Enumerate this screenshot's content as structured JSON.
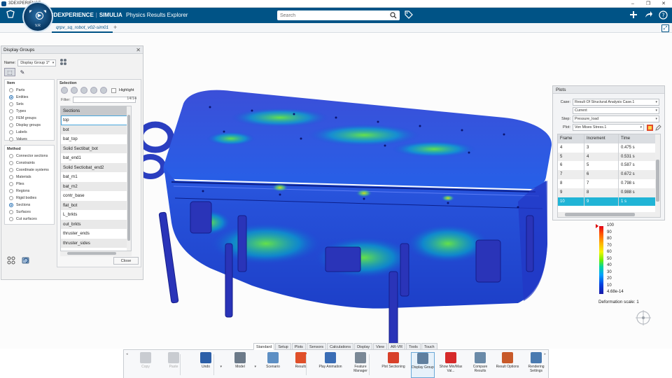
{
  "os": {
    "app_name": "3DEXPERIENCE",
    "minimize": "–",
    "restore": "❐",
    "close": "✕"
  },
  "header": {
    "brand": "3DEXPERIENCE",
    "separator": "|",
    "product": "SIMULIA",
    "app": "Physics Results Explorer",
    "compass_version": "V.R",
    "search_placeholder": "Search"
  },
  "tabs": {
    "document": "qrpv_sq_robot_v02-sim01",
    "add": "+"
  },
  "display_groups": {
    "title": "Display Groups",
    "name_label": "Name:",
    "name_value": "Display Group 1*",
    "item_header": "Item",
    "items": [
      {
        "label": "Parts",
        "selected": false
      },
      {
        "label": "Entities",
        "selected": true
      },
      {
        "label": "Sets",
        "selected": false
      },
      {
        "label": "Types",
        "selected": false
      },
      {
        "label": "FEM groups",
        "selected": false
      },
      {
        "label": "Display groups",
        "selected": false
      },
      {
        "label": "Labels",
        "selected": false
      },
      {
        "label": "Values",
        "selected": false
      }
    ],
    "method_header": "Method",
    "methods": [
      {
        "label": "Connector sections",
        "selected": false
      },
      {
        "label": "Constraints",
        "selected": false
      },
      {
        "label": "Coordinate systems",
        "selected": false
      },
      {
        "label": "Materials",
        "selected": false
      },
      {
        "label": "Plies",
        "selected": false
      },
      {
        "label": "Regions",
        "selected": false
      },
      {
        "label": "Rigid bodies",
        "selected": false
      },
      {
        "label": "Sections",
        "selected": true
      },
      {
        "label": "Surfaces",
        "selected": false
      },
      {
        "label": "Cut surfaces",
        "selected": false
      }
    ],
    "selection_header": "Selection",
    "highlight_label": "Highlight",
    "filter_label": "Filter:",
    "filter_value": "",
    "filter_count": "14/14",
    "sections_header": "Sections",
    "sections": [
      "top",
      "bot",
      "bat_top",
      "Solid Sectibat_bot",
      "bat_end1",
      "Solid Sectiobat_end2",
      "bat_m1",
      "bat_m2",
      "contr_base",
      "flat_bot",
      "L_brkts",
      "out_brkts",
      "thruster_ends",
      "thruster_sides"
    ],
    "close_label": "Close"
  },
  "plots": {
    "title": "Plots",
    "case_label": "Case:",
    "case_value": "Result Of Structural Analysis Case.1",
    "current_value": "Current",
    "step_label": "Step:",
    "step_value": "Pressure_load",
    "plot_label": "Plot:",
    "plot_value": "Von Mises Stress.1",
    "columns": [
      "Frame",
      "Increment",
      "Time"
    ],
    "rows": [
      {
        "frame": "4",
        "increment": "3",
        "time": "0.475 s"
      },
      {
        "frame": "5",
        "increment": "4",
        "time": "0.531 s"
      },
      {
        "frame": "6",
        "increment": "5",
        "time": "0.587 s"
      },
      {
        "frame": "7",
        "increment": "6",
        "time": "0.672 s"
      },
      {
        "frame": "8",
        "increment": "7",
        "time": "0.798 s"
      },
      {
        "frame": "9",
        "increment": "8",
        "time": "0.988 s"
      },
      {
        "frame": "10",
        "increment": "9",
        "time": "1 s"
      }
    ],
    "selected_frame": "10"
  },
  "legend": {
    "ticks": [
      "100",
      "90",
      "80",
      "70",
      "60",
      "50",
      "40",
      "30",
      "20",
      "10",
      "4.68e-14"
    ],
    "deformation_label": "Deformation scale: 1"
  },
  "section_tabs": [
    "Standard",
    "Setup",
    "Plots",
    "Sensors",
    "Calculations",
    "Display",
    "View",
    "AR-VR",
    "Tools",
    "Touch"
  ],
  "active_section_tab": "Standard",
  "actions": [
    {
      "id": "copy",
      "label": "Copy",
      "disabled": true,
      "color": "#c9ccd1"
    },
    {
      "id": "paste",
      "label": "Paste",
      "disabled": true,
      "color": "#c9ccd1"
    },
    {
      "id": "undo",
      "label": "Undo",
      "disabled": false,
      "color": "#2c5fa8"
    },
    {
      "id": "model",
      "label": "Model",
      "disabled": false,
      "color": "#6c7a89"
    },
    {
      "id": "scenario",
      "label": "Scenario",
      "disabled": false,
      "color": "#5d8fc4"
    },
    {
      "id": "results",
      "label": "Results",
      "disabled": false,
      "color": "#e0502a"
    },
    {
      "id": "play-animation",
      "label": "Play Animation",
      "disabled": false,
      "color": "#3a6db5"
    },
    {
      "id": "feature-manager",
      "label": "Feature Manager",
      "disabled": false,
      "color": "#7a8896"
    },
    {
      "id": "plot-sectioning",
      "label": "Plot Sectioning",
      "disabled": false,
      "color": "#d8402a"
    },
    {
      "id": "display-group",
      "label": "Display Group",
      "disabled": false,
      "color": "#5f7f9f"
    },
    {
      "id": "show-minmax",
      "label": "Show Min/Max Val...",
      "disabled": false,
      "color": "#d62a2a"
    },
    {
      "id": "compare-results",
      "label": "Compare Results",
      "disabled": false,
      "color": "#6a8aa8"
    },
    {
      "id": "result-options",
      "label": "Result Options",
      "disabled": false,
      "color": "#c85a2a"
    },
    {
      "id": "rendering-settings",
      "label": "Rendering Settings",
      "disabled": false,
      "color": "#4a7ab0"
    }
  ],
  "active_action": "display-group",
  "colors": {
    "header": "#005386",
    "selected_row": "#20b4d6",
    "model_base": "#1a48d8"
  }
}
